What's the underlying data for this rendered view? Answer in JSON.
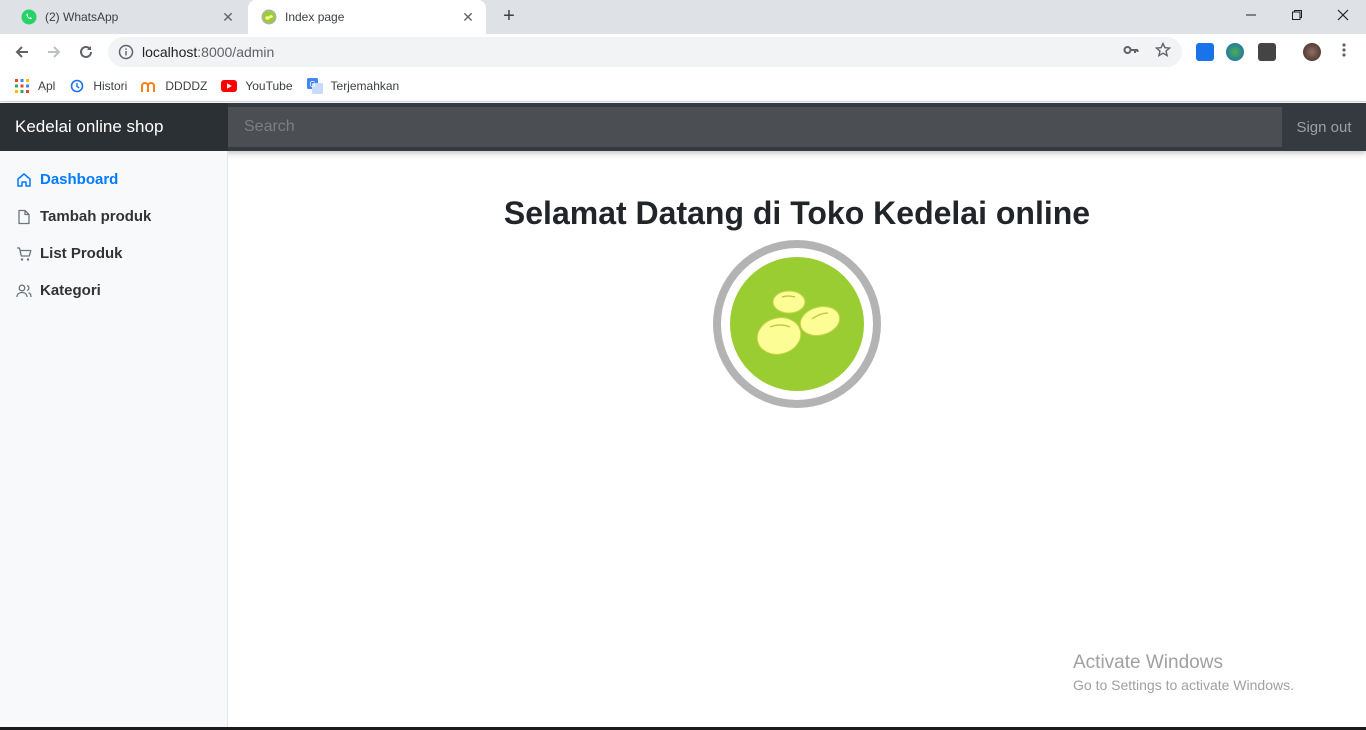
{
  "browser": {
    "tabs": [
      {
        "title": "(2) WhatsApp",
        "active": false
      },
      {
        "title": "Index page",
        "active": true
      }
    ],
    "url_host": "localhost",
    "url_rest": ":8000/admin",
    "bookmarks": [
      "Apl",
      "Histori",
      "DDDDZ",
      "YouTube",
      "Terjemahkan"
    ]
  },
  "navbar": {
    "brand": "Kedelai online shop",
    "search_placeholder": "Search",
    "signout": "Sign out"
  },
  "sidebar": {
    "items": [
      {
        "label": "Dashboard",
        "icon": "home-icon",
        "active": true
      },
      {
        "label": "Tambah produk",
        "icon": "file-icon",
        "active": false
      },
      {
        "label": "List Produk",
        "icon": "cart-icon",
        "active": false
      },
      {
        "label": "Kategori",
        "icon": "users-icon",
        "active": false
      }
    ]
  },
  "main": {
    "heading": "Selamat Datang di Toko Kedelai online"
  },
  "watermark": {
    "line1": "Activate Windows",
    "line2": "Go to Settings to activate Windows."
  },
  "colors": {
    "navbar": "#343a40",
    "accent": "#007bff",
    "logo_green": "#9acd32",
    "logo_bean": "#fdfd96"
  }
}
